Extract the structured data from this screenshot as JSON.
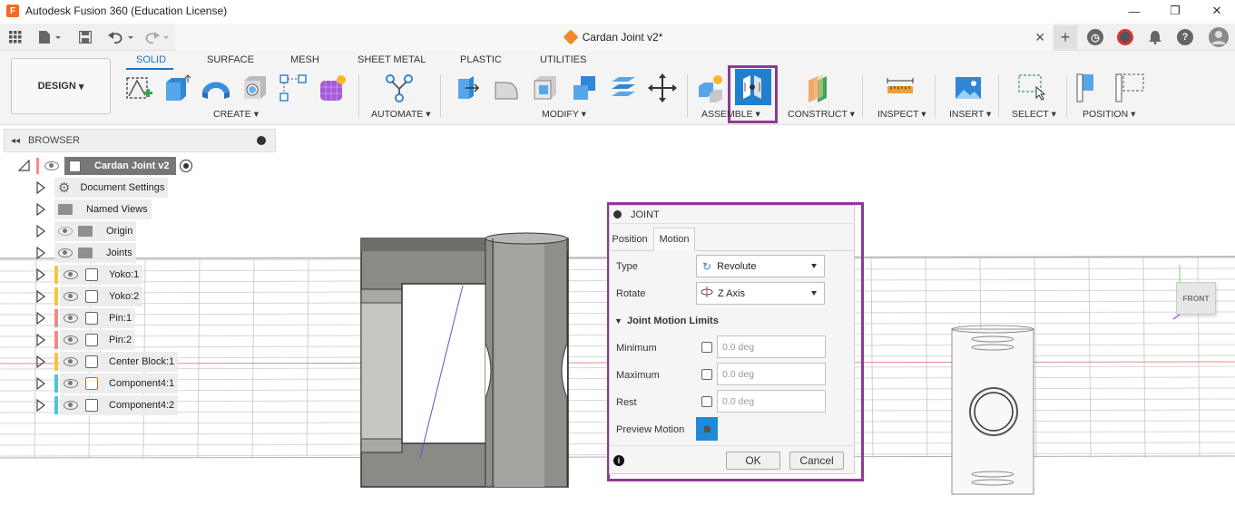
{
  "app": {
    "title": "Autodesk Fusion 360 (Education License)",
    "logo_letter": "F",
    "window_controls": [
      "—",
      "❐",
      "✕"
    ]
  },
  "tabbar": {
    "document_tab": "Cardan Joint v2*",
    "close_label": "✕",
    "add_label": "+"
  },
  "ribbon": {
    "workspace": "DESIGN",
    "tabs": [
      "SOLID",
      "SURFACE",
      "MESH",
      "SHEET METAL",
      "PLASTIC",
      "UTILITIES"
    ],
    "active_tab": "SOLID",
    "groups": {
      "create": "CREATE",
      "automate": "AUTOMATE",
      "modify": "MODIFY",
      "assemble": "ASSEMBLE",
      "construct": "CONSTRUCT",
      "inspect": "INSPECT",
      "insert": "INSERT",
      "select": "SELECT",
      "position": "POSITION"
    }
  },
  "browser": {
    "title": "BROWSER",
    "root": "Cardan Joint v2",
    "items": [
      {
        "label": "Document Settings",
        "icon": "gear-icon"
      },
      {
        "label": "Named Views",
        "icon": "folder-icon"
      },
      {
        "label": "Origin",
        "icon": "folder-icon"
      },
      {
        "label": "Joints",
        "icon": "folder-icon"
      },
      {
        "label": "Yoko:1",
        "icon": "component-icon",
        "color": "#f5c542"
      },
      {
        "label": "Yoko:2",
        "icon": "component-icon",
        "color": "#f5c542"
      },
      {
        "label": "Pin:1",
        "icon": "component-icon",
        "color": "#f08a8a"
      },
      {
        "label": "Pin:2",
        "icon": "component-icon",
        "color": "#f08a8a"
      },
      {
        "label": "Center Block:1",
        "icon": "component-icon",
        "color": "#f5c542"
      },
      {
        "label": "Component4:1",
        "icon": "component-icon",
        "color": "#4fc3d9"
      },
      {
        "label": "Component4:2",
        "icon": "component-icon",
        "color": "#4fc3d9"
      }
    ]
  },
  "joint": {
    "title": "JOINT",
    "tabs": [
      "Position",
      "Motion"
    ],
    "active_tab": "Motion",
    "type_label": "Type",
    "type_value": "Revolute",
    "rotate_label": "Rotate",
    "rotate_value": "Z Axis",
    "limits_heading": "Joint Motion Limits",
    "minimum_label": "Minimum",
    "minimum_value": "0.0 deg",
    "maximum_label": "Maximum",
    "maximum_value": "0.0 deg",
    "rest_label": "Rest",
    "rest_value": "0.0 deg",
    "preview_label": "Preview Motion",
    "ok_label": "OK",
    "cancel_label": "Cancel",
    "info_symbol": "i"
  },
  "viewcube": {
    "face": "FRONT"
  },
  "colors": {
    "accent": "#1a73c9",
    "highlight": "#8e3a95"
  }
}
